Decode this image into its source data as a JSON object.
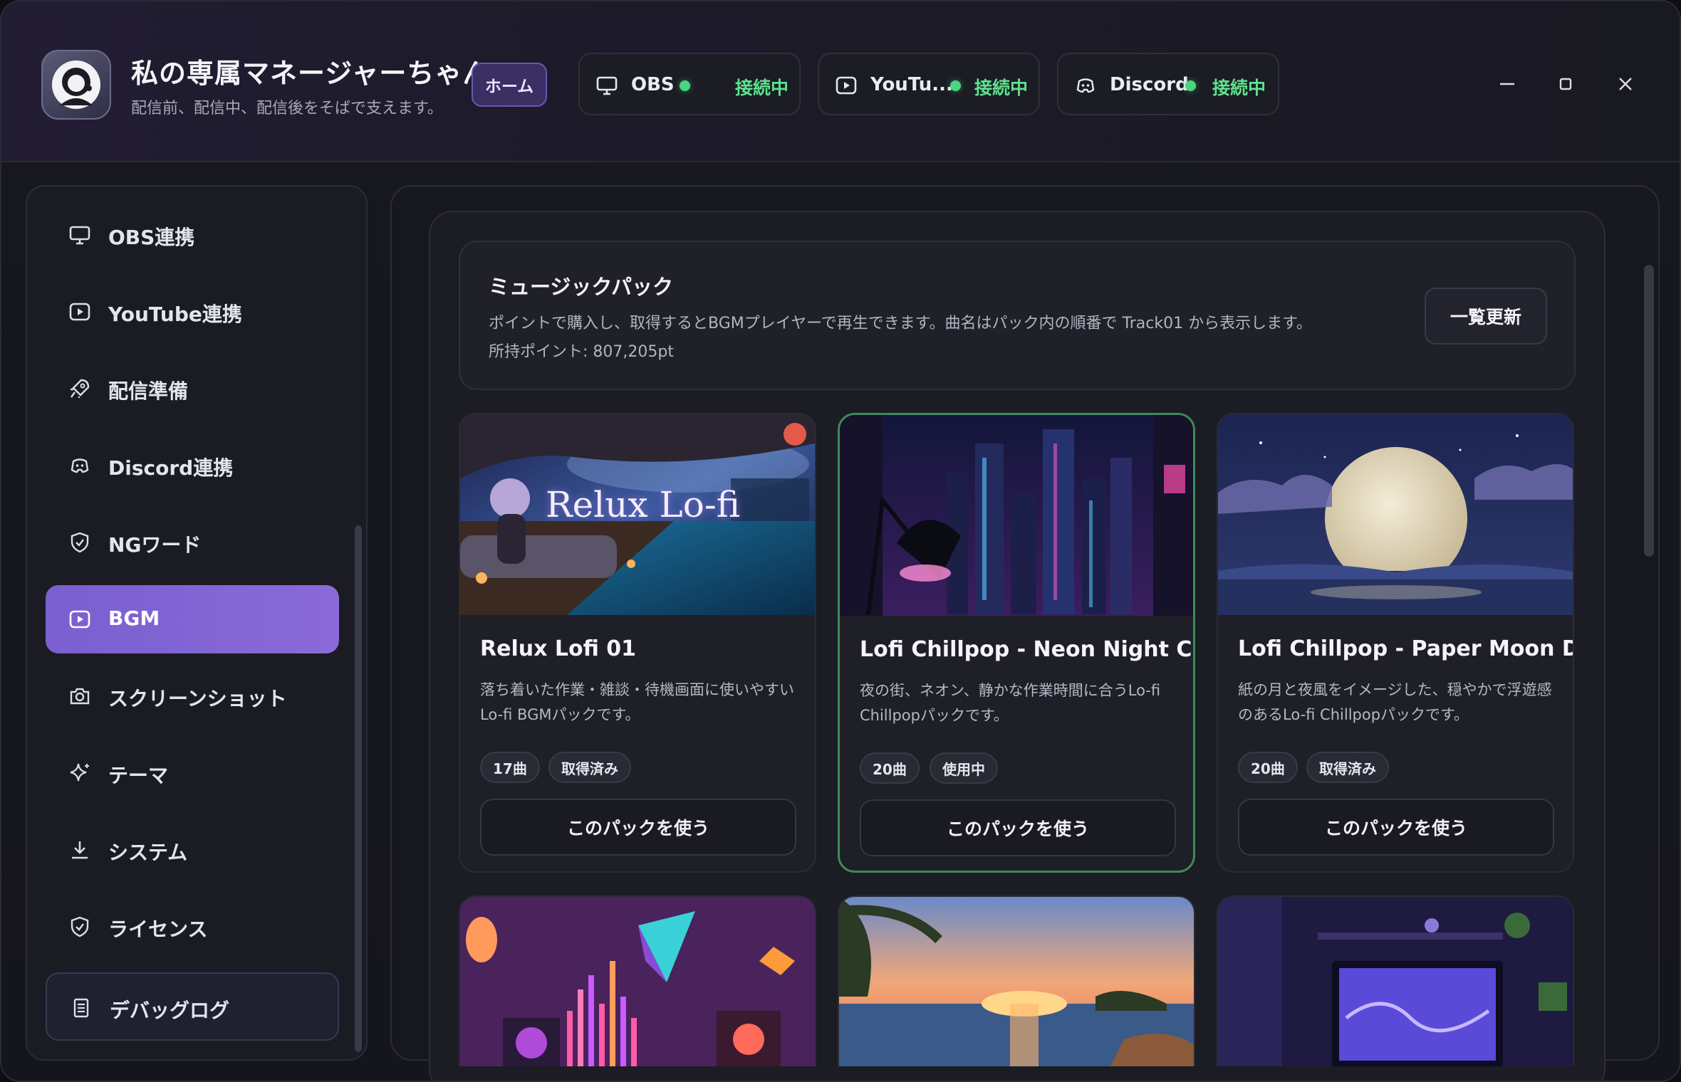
{
  "app": {
    "title": "私の専属マネージャーちゃん",
    "subtitle": "配信前、配信中、配信後をそばで支えます。",
    "home_label": "ホーム"
  },
  "status": [
    {
      "name": "OBS",
      "status": "接続中",
      "icon": "monitor-icon"
    },
    {
      "name": "YouTu...",
      "status": "接続中",
      "icon": "play-icon"
    },
    {
      "name": "Discord",
      "status": "接続中",
      "icon": "discord-icon"
    }
  ],
  "sidebar": {
    "items": [
      {
        "label": "OBS連携",
        "icon": "monitor-icon"
      },
      {
        "label": "YouTube連携",
        "icon": "play-icon"
      },
      {
        "label": "配信準備",
        "icon": "rocket-icon"
      },
      {
        "label": "Discord連携",
        "icon": "discord-icon"
      },
      {
        "label": "NGワード",
        "icon": "shield-icon"
      },
      {
        "label": "BGM",
        "icon": "play-icon",
        "active": true
      },
      {
        "label": "スクリーンショット",
        "icon": "camera-icon"
      },
      {
        "label": "テーマ",
        "icon": "sparkle-icon"
      },
      {
        "label": "システム",
        "icon": "download-icon"
      },
      {
        "label": "ライセンス",
        "icon": "shield-icon"
      }
    ],
    "debug_label": "デバッグログ"
  },
  "music": {
    "title": "ミュージックパック",
    "description": "ポイントで購入し、取得するとBGMプレイヤーで再生できます。曲名はパック内の順番で Track01 から表示します。",
    "points": "所持ポイント: 807,205pt",
    "refresh_label": "一覧更新",
    "use_label": "このパックを使う",
    "packs": [
      {
        "title": "Relux Lofi 01",
        "art_text": "Relux Lo-fi",
        "description": "落ち着いた作業・雑談・待機画面に使いやすいLo-fi BGMパックです。",
        "tracks": "17曲",
        "state": "取得済み"
      },
      {
        "title": "Lofi Chillpop - Neon Night City",
        "description": "夜の街、ネオン、静かな作業時間に合うLo-fi Chillpopパックです。",
        "tracks": "20曲",
        "state": "使用中"
      },
      {
        "title": "Lofi Chillpop - Paper Moon Drift",
        "description": "紙の月と夜風をイメージした、穏やかで浮遊感のあるLo-fi Chillpopパックです。",
        "tracks": "20曲",
        "state": "取得済み"
      }
    ]
  },
  "colors": {
    "accent": "#7a5fd0",
    "connected": "#48d67e",
    "in_use_border": "#3e8a5a"
  }
}
